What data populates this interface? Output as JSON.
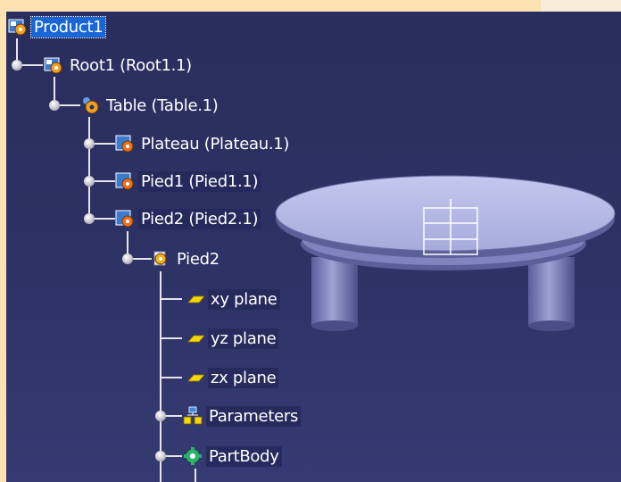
{
  "tree": {
    "nodes": [
      {
        "label": "Product1",
        "icon": "product-icon",
        "selected": true
      },
      {
        "label": "Root1 (Root1.1)",
        "icon": "product-icon"
      },
      {
        "label": "Table (Table.1)",
        "icon": "product-gear-icon"
      },
      {
        "label": "Plateau (Plateau.1)",
        "icon": "part-icon"
      },
      {
        "label": "Pied1 (Pied1.1)",
        "icon": "part-icon"
      },
      {
        "label": "Pied2 (Pied2.1)",
        "icon": "part-icon"
      },
      {
        "label": "Pied2",
        "icon": "part-body-gear-icon"
      },
      {
        "label": "xy plane",
        "icon": "plane-icon"
      },
      {
        "label": "yz plane",
        "icon": "plane-icon"
      },
      {
        "label": "zx plane",
        "icon": "plane-icon"
      },
      {
        "label": "Parameters",
        "icon": "parameters-icon"
      },
      {
        "label": "PartBody",
        "icon": "partbody-icon"
      }
    ]
  },
  "colors": {
    "background": "#2c3163",
    "selection": "#1966d6",
    "plane": "#f5d800",
    "table_top": "#aeb2e0"
  }
}
